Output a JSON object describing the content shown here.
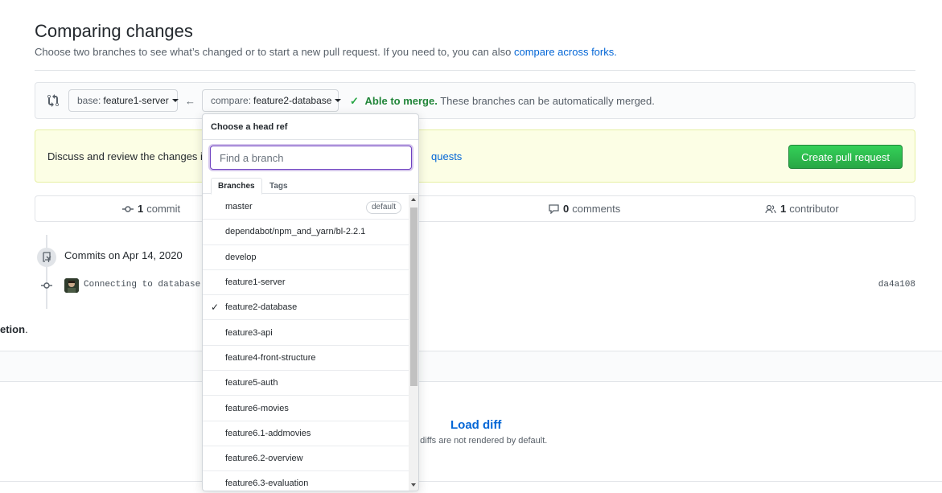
{
  "header": {
    "title": "Comparing changes",
    "subtitle": "Choose two branches to see what’s changed or to start a new pull request. If you need to, you can also",
    "subtitle_link": "compare across forks."
  },
  "range": {
    "base_label": "base:",
    "base_ref": "feature1-server",
    "compare_label": "compare:",
    "compare_ref": "feature2-database",
    "merge_status_strong": "Able to merge.",
    "merge_status_text": "These branches can be automatically merged."
  },
  "flash": {
    "text": "Discuss and review the changes in",
    "link": "quests",
    "button": "Create pull request"
  },
  "stats": {
    "commits_count": "1",
    "commits_label": "commit",
    "comments_count": "0",
    "comments_label": "comments",
    "contributors_count": "1",
    "contributors_label": "contributor"
  },
  "commits": {
    "group_title": "Commits on Apr 14, 2020",
    "items": [
      {
        "message": "Connecting to database",
        "sha": "da4a108"
      }
    ]
  },
  "files": {
    "partial_text": "etion",
    "load_diff": "Load diff",
    "diff_note": "e diffs are not rendered by default."
  },
  "dropdown": {
    "title": "Choose a head ref",
    "filter_placeholder": "Find a branch",
    "tabs": [
      "Branches",
      "Tags"
    ],
    "selected": "feature2-database",
    "default_badge": "default",
    "branches": [
      "master",
      "dependabot/npm_and_yarn/bl-2.2.1",
      "develop",
      "feature1-server",
      "feature2-database",
      "feature3-api",
      "feature4-front-structure",
      "feature5-auth",
      "feature6-movies",
      "feature6.1-addmovies",
      "feature6.2-overview",
      "feature6.3-evaluation"
    ]
  }
}
